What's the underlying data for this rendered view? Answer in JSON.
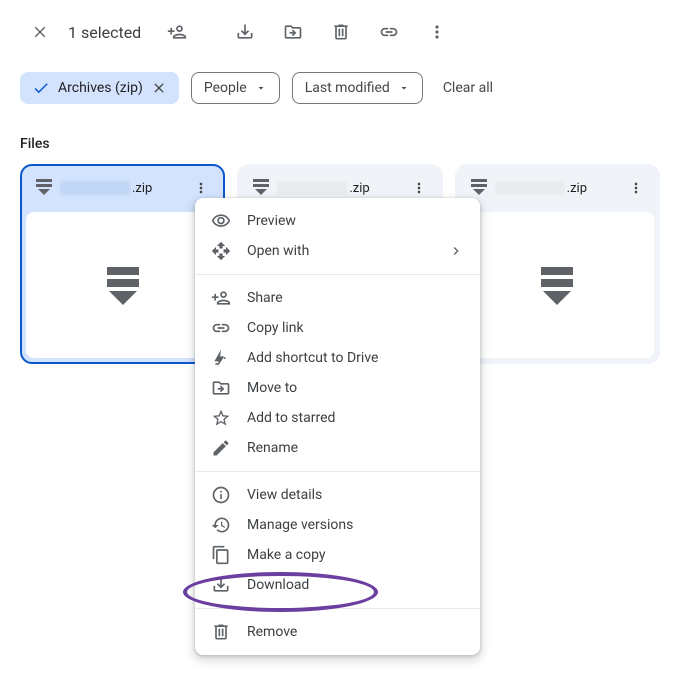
{
  "toolbar": {
    "selected_text": "1 selected"
  },
  "filters": {
    "archives_label": "Archives (zip)",
    "people_label": "People",
    "last_modified_label": "Last modified",
    "clear_all": "Clear all"
  },
  "section": {
    "title": "Files"
  },
  "files": [
    {
      "ext": ".zip",
      "selected": true
    },
    {
      "ext": ".zip",
      "selected": false
    },
    {
      "ext": ".zip",
      "selected": false
    }
  ],
  "menu": {
    "preview": "Preview",
    "open_with": "Open with",
    "share": "Share",
    "copy_link": "Copy link",
    "add_shortcut": "Add shortcut to Drive",
    "move_to": "Move to",
    "add_starred": "Add to starred",
    "rename": "Rename",
    "view_details": "View details",
    "manage_versions": "Manage versions",
    "make_copy": "Make a copy",
    "download": "Download",
    "remove": "Remove"
  }
}
